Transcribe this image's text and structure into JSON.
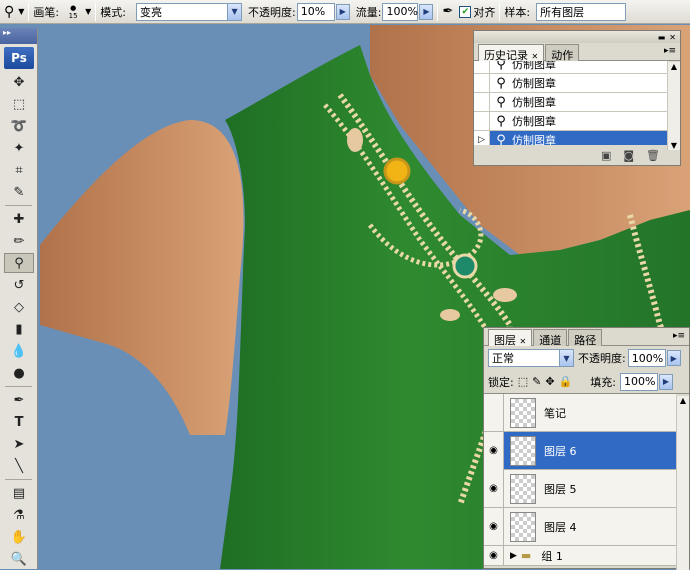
{
  "options_bar": {
    "brush_label": "画笔:",
    "brush_size": "15",
    "mode_label": "模式:",
    "mode_value": "变亮",
    "opacity_label": "不透明度:",
    "opacity_value": "10%",
    "flow_label": "流量:",
    "flow_value": "100%",
    "aligned_label": "对齐",
    "aligned_checked": true,
    "sample_label": "样本:",
    "sample_value": "所有图层"
  },
  "toolbox": {
    "logo": "Ps"
  },
  "history_panel": {
    "tabs": [
      {
        "label": "历史记录",
        "active": true
      },
      {
        "label": "动作",
        "active": false
      }
    ],
    "items": [
      {
        "label": "仿制图章",
        "selected": false
      },
      {
        "label": "仿制图章",
        "selected": false
      },
      {
        "label": "仿制图章",
        "selected": false
      },
      {
        "label": "仿制图章",
        "selected": false
      },
      {
        "label": "仿制图章",
        "selected": true
      }
    ]
  },
  "layers_panel": {
    "tabs": [
      {
        "label": "图层",
        "active": true
      },
      {
        "label": "通道",
        "active": false
      },
      {
        "label": "路径",
        "active": false
      }
    ],
    "blend_mode": "正常",
    "opacity_label": "不透明度:",
    "opacity_value": "100%",
    "lock_label": "锁定:",
    "fill_label": "填充:",
    "fill_value": "100%",
    "layers": [
      {
        "name": "笔记",
        "visible": false,
        "selected": false
      },
      {
        "name": "图层 6",
        "visible": true,
        "selected": true
      },
      {
        "name": "图层 5",
        "visible": true,
        "selected": false
      },
      {
        "name": "图层 4",
        "visible": true,
        "selected": false
      },
      {
        "name": "组 1",
        "visible": true,
        "selected": false
      }
    ]
  },
  "colors": {
    "selection": "#316ac5",
    "dress": "#2f8a2f",
    "background": "#6a8fb7",
    "skin": "#c98e63"
  }
}
